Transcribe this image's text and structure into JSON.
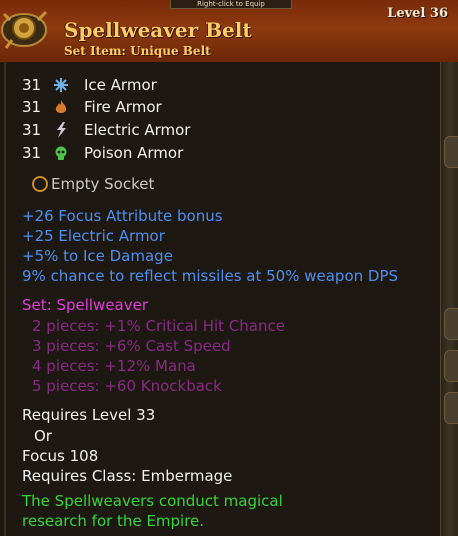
{
  "header": {
    "hint": "Right-click to Equip",
    "title": "Spellweaver Belt",
    "subtitle": "Set Item: Unique Belt",
    "level": "Level 36"
  },
  "armor": [
    {
      "value": "31",
      "icon": "ice-icon",
      "label": "Ice Armor",
      "color": "#6fb2e8"
    },
    {
      "value": "31",
      "icon": "fire-icon",
      "label": "Fire Armor",
      "color": "#d67a2a"
    },
    {
      "value": "31",
      "icon": "electric-icon",
      "label": "Electric Armor",
      "color": "#c8c8d8"
    },
    {
      "value": "31",
      "icon": "poison-icon",
      "label": "Poison Armor",
      "color": "#4fc24a"
    }
  ],
  "socket": {
    "label": "Empty Socket"
  },
  "bonuses": [
    "+26 Focus Attribute bonus",
    "+25 Electric Armor",
    "+5% to Ice Damage",
    "9% chance to reflect missiles at 50% weapon DPS"
  ],
  "set": {
    "title": "Set: Spellweaver",
    "pieces": [
      "2 pieces: +1% Critical Hit Chance",
      "3 pieces: +6% Cast Speed",
      "4 pieces: +12% Mana",
      "5 pieces: +60 Knockback"
    ]
  },
  "requirements": {
    "level": "Requires Level 33",
    "or": "Or",
    "focus": "Focus 108",
    "class": "Requires Class: Embermage"
  },
  "lore": [
    "The Spellweavers conduct magical",
    "research for the Empire."
  ]
}
